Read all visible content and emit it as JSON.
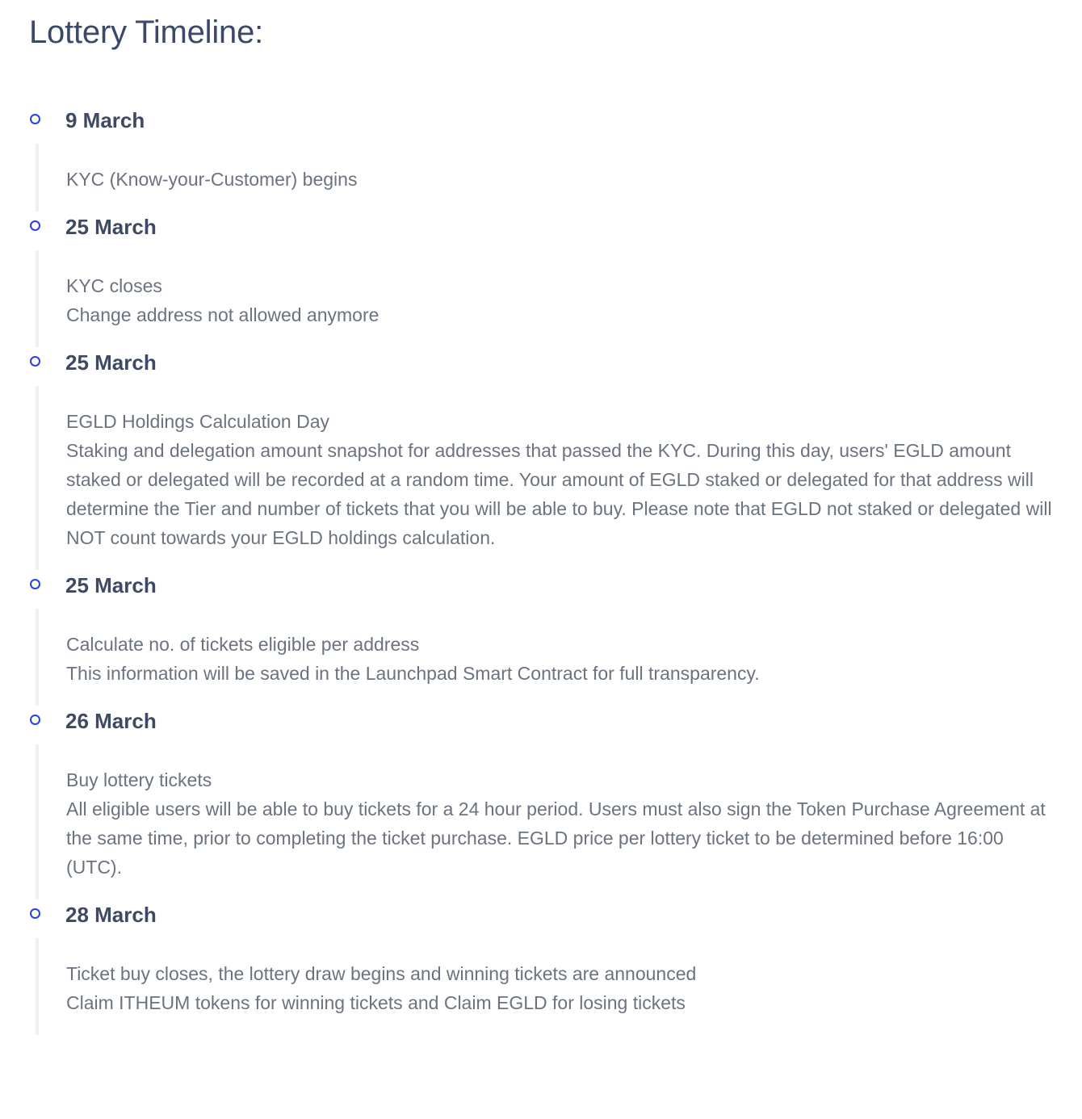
{
  "page": {
    "title": "Lottery Timeline:"
  },
  "timeline": {
    "events": [
      {
        "date": "9 March",
        "lines": [
          "KYC (Know-your-Customer) begins"
        ]
      },
      {
        "date": "25 March",
        "lines": [
          "KYC closes",
          "Change address not allowed anymore"
        ]
      },
      {
        "date": "25 March",
        "lines": [
          "EGLD Holdings Calculation Day",
          "Staking and delegation amount snapshot for addresses that passed the KYC. During this day, users' EGLD amount staked or delegated will be recorded at a random time. Your amount of EGLD staked or delegated for that address will determine the Tier and number of tickets that you will be able to buy. Please note that EGLD not staked or delegated will NOT count towards your EGLD holdings calculation."
        ]
      },
      {
        "date": "25 March",
        "lines": [
          "Calculate no. of tickets eligible per address",
          "This information will be saved in the Launchpad Smart Contract for full transparency."
        ]
      },
      {
        "date": "26 March",
        "lines": [
          "Buy lottery tickets",
          "All eligible users will be able to buy tickets for a 24 hour period. Users must also sign the Token Purchase Agreement at the same time, prior to completing the ticket purchase. EGLD price per lottery ticket to be determined before 16:00 (UTC)."
        ]
      },
      {
        "date": "28 March",
        "lines": [
          "Ticket buy closes, the lottery draw begins and winning tickets are announced",
          "Claim ITHEUM tokens for winning tickets and Claim EGLD for losing tickets"
        ]
      }
    ]
  },
  "colors": {
    "marker": "#2d3fe0",
    "title": "#3b4868",
    "date": "#3e4a63",
    "body": "#6b7280",
    "rail": "#eef0f3"
  },
  "icons": {
    "marker": "circle-outline-icon"
  }
}
